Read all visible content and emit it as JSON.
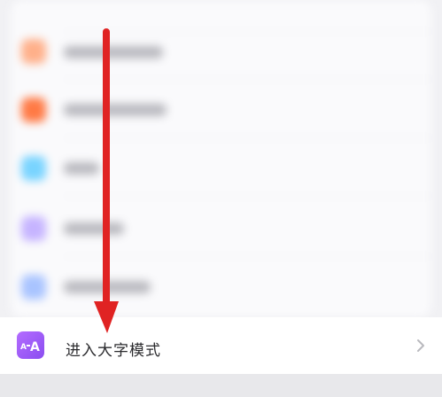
{
  "settings_item": {
    "label": "进入大字模式",
    "icon": "large-font-mode-icon",
    "chevron_icon": "chevron-right-icon"
  },
  "annotation": {
    "icon": "down-arrow-annotation",
    "color": "#e02323"
  },
  "colors": {
    "accent_icon_gradient": [
      "#b46cff",
      "#8a4df0"
    ],
    "blurred_icon_colors": [
      "#ffb08a",
      "#ff7a45",
      "#79d4ff",
      "#c6b4ff",
      "#a9c4ff"
    ]
  }
}
